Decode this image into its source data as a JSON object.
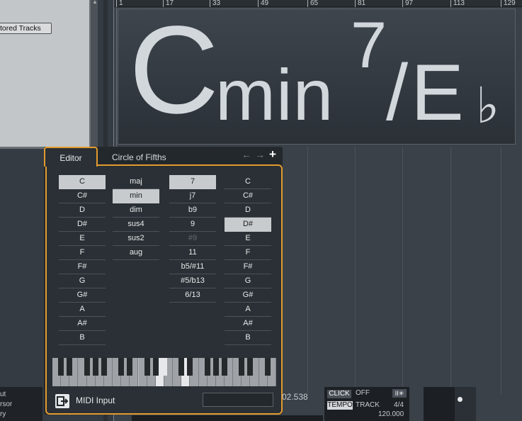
{
  "left_panel": {
    "restored_tracks_label": "tored Tracks",
    "scroll_arrow": "▲"
  },
  "ruler": {
    "marks": [
      "1",
      "17",
      "33",
      "49",
      "65",
      "81",
      "97",
      "113",
      "129"
    ]
  },
  "chord_display": {
    "root": "C",
    "quality": "min",
    "extension": "7",
    "bass": "/E",
    "bass_accidental": "♭"
  },
  "popup": {
    "tabs": {
      "editor": "Editor",
      "circle_of_fifths": "Circle of Fifths"
    },
    "nav_prev": "←",
    "nav_next": "→",
    "add": "+",
    "roots": [
      "C",
      "C#",
      "D",
      "D#",
      "E",
      "F",
      "F#",
      "G",
      "G#",
      "A",
      "A#",
      "B"
    ],
    "selected_root": "C",
    "qualities": [
      "maj",
      "min",
      "dim",
      "sus4",
      "sus2",
      "aug"
    ],
    "selected_quality": "min",
    "extensions": [
      "7",
      "j7",
      "b9",
      "9",
      "#9",
      "11",
      "b5/#11",
      "#5/b13",
      "6/13"
    ],
    "selected_extension": "7",
    "disabled_extension": "#9",
    "bass_notes": [
      "C",
      "C#",
      "D",
      "D#",
      "E",
      "F",
      "F#",
      "G",
      "G#",
      "A",
      "A#",
      "B"
    ],
    "selected_bass": "D#",
    "midi_input_label": "MIDI Input"
  },
  "bottom_left": {
    "lines": [
      "ut",
      "rsor",
      "ry"
    ]
  },
  "transport": {
    "time": "02.538",
    "click_label": "CLICK",
    "click_value": "OFF",
    "click_icon": "II✳",
    "tempo_label": "TEMPO",
    "tempo_mode": "TRACK",
    "time_signature": "4/4",
    "tempo_value": "120.000"
  }
}
